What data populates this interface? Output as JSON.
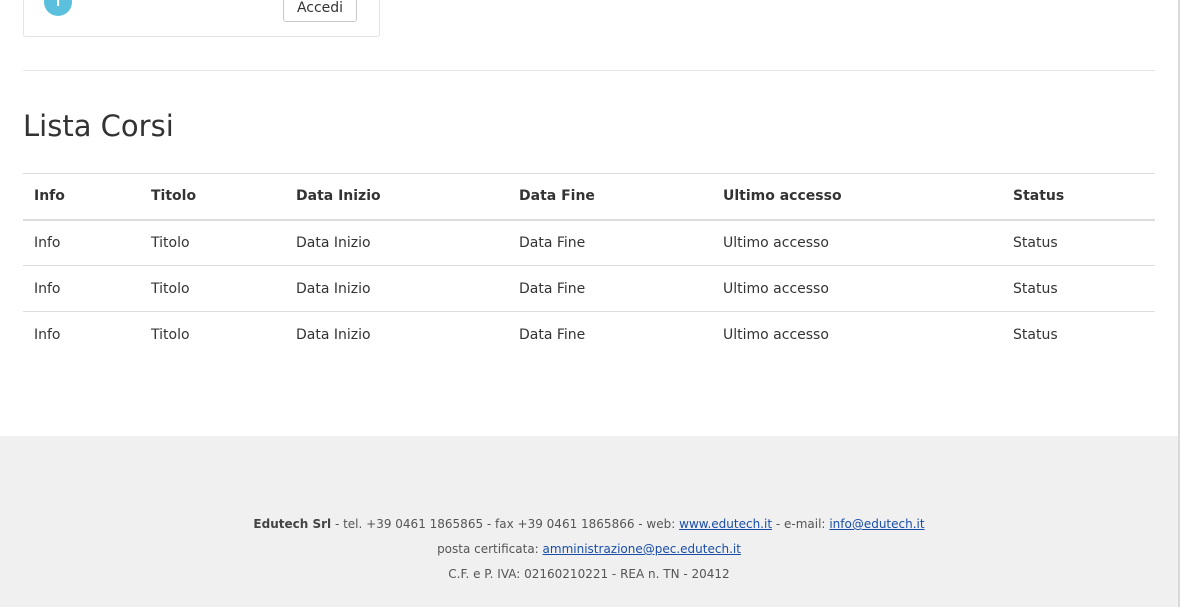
{
  "login_card": {
    "info_icon": "info-icon",
    "button_label": "Accedi"
  },
  "courses": {
    "title": "Lista Corsi",
    "columns": [
      "Info",
      "Titolo",
      "Data Inizio",
      "Data Fine",
      "Ultimo accesso",
      "Status"
    ],
    "rows": [
      [
        "Info",
        "Titolo",
        "Data Inizio",
        "Data Fine",
        "Ultimo accesso",
        "Status"
      ],
      [
        "Info",
        "Titolo",
        "Data Inizio",
        "Data Fine",
        "Ultimo accesso",
        "Status"
      ],
      [
        "Info",
        "Titolo",
        "Data Inizio",
        "Data Fine",
        "Ultimo accesso",
        "Status"
      ]
    ]
  },
  "footer": {
    "company": "Edutech Srl",
    "contacts": "-  tel. +39 0461 1865865  -  fax +39 0461 1865866 - web:",
    "web_link": "www.edutech.it",
    "email_prefix": "- e-mail:",
    "email_link": "info@edutech.it",
    "pec_label": "posta certificata:",
    "pec_link": "amministrazione@pec.edutech.it",
    "fiscal": "C.F. e P. IVA: 02160210221  -  REA n. TN - 20412"
  },
  "colors": {
    "info_accent": "#5bc0de",
    "link": "#1a4ea8",
    "footer_bg": "#f0f0f0"
  }
}
